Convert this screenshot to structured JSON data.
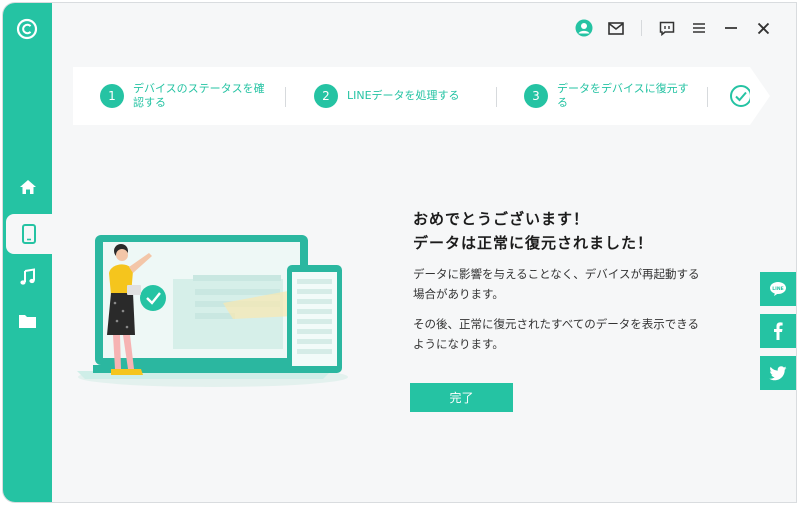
{
  "topbar": {
    "icons": [
      "user-icon",
      "mail-icon",
      "feedback-icon",
      "menu-icon",
      "minimize-icon",
      "close-icon"
    ]
  },
  "sidebar": {
    "items": [
      {
        "name": "home",
        "icon": "home-icon",
        "active": false
      },
      {
        "name": "device",
        "icon": "phone-icon",
        "active": true
      },
      {
        "name": "music",
        "icon": "music-icon",
        "active": false
      },
      {
        "name": "folder",
        "icon": "folder-icon",
        "active": false
      }
    ]
  },
  "steps": [
    {
      "number": "1",
      "label_line1": "デバイスのステータスを確",
      "label_line2": "認する"
    },
    {
      "number": "2",
      "label_line1": "LINEデータを処理する",
      "label_line2": ""
    },
    {
      "number": "3",
      "label_line1": "データをデバイスに復元す",
      "label_line2": "る"
    }
  ],
  "main": {
    "title_line1": "おめでとうございます！",
    "title_line2": "データは正常に復元されました！",
    "desc1_line1": "データに影響を与えることなく、デバイスが再起動する",
    "desc1_line2": "場合があります。",
    "desc2_line1": "その後、正常に復元されたすべてのデータを表示できる",
    "desc2_line2": "ようになります。",
    "done_button": "完了"
  },
  "social": [
    "line-icon",
    "facebook-icon",
    "twitter-icon"
  ],
  "colors": {
    "accent": "#25c3a3",
    "background": "#f6f7f8",
    "text": "#1c1c1c"
  }
}
